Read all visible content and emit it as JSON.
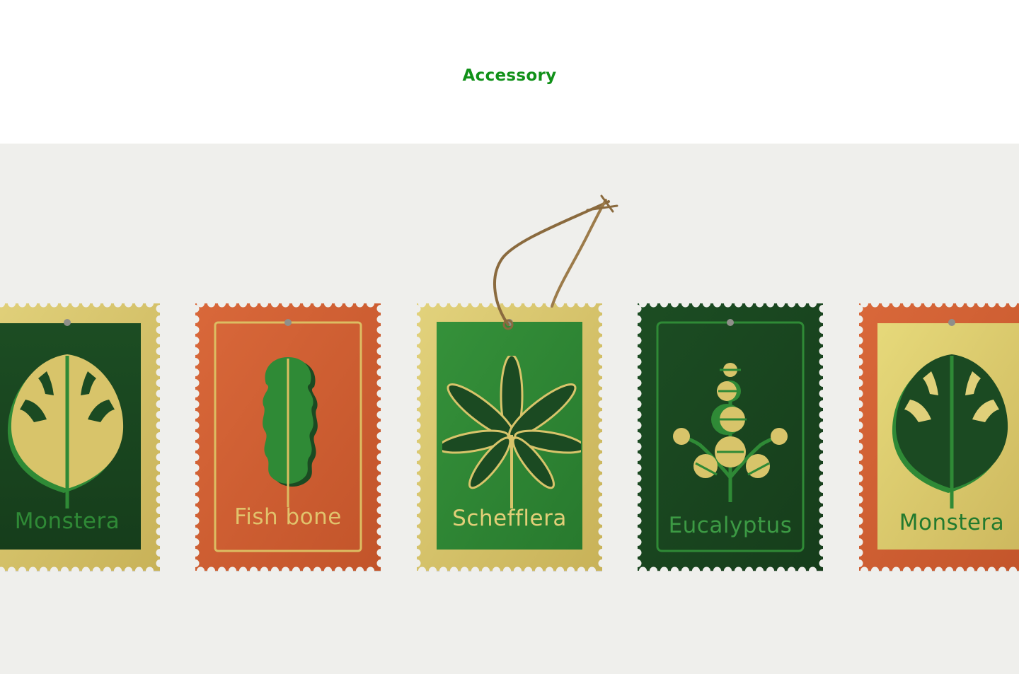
{
  "header": {
    "title": "Accessory"
  },
  "stamps": [
    {
      "name": "Monstera",
      "edge": "gold",
      "panel": "forest",
      "label_color": "#2f8a36"
    },
    {
      "name": "Fish bone",
      "edge": "orange",
      "panel": "orange",
      "label_color": "#e1c36c"
    },
    {
      "name": "Schefflera",
      "edge": "gold",
      "panel": "green",
      "label_color": "#e2cf78"
    },
    {
      "name": "Eucalyptus",
      "edge": "forest",
      "panel": "forest",
      "label_color": "#3c9a44"
    },
    {
      "name": "Monstera",
      "edge": "orange",
      "panel": "gold",
      "label_color": "#227a2e"
    }
  ],
  "colors": {
    "accent": "#119119",
    "gold": "#d8c46a",
    "orange": "#cf5a2b",
    "forest": "#1b4a22",
    "leaf_green": "#2f8a36",
    "backdrop": "#efefec"
  },
  "icons": [
    "monstera-leaf-icon",
    "fish-bone-leaf-icon",
    "schefflera-leaf-icon",
    "eucalyptus-branch-icon",
    "twine-string-icon"
  ]
}
